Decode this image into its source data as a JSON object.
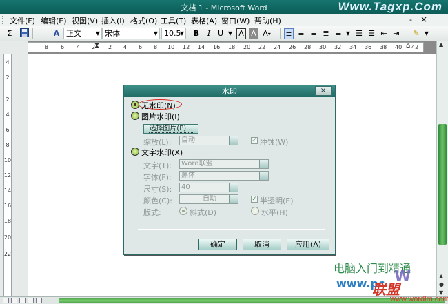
{
  "window": {
    "title": "文档 1 - Microsoft Word",
    "brand_mark": "Www.Tagxp.Com"
  },
  "menu": {
    "items": [
      "文件(F)",
      "编辑(E)",
      "视图(V)",
      "插入(I)",
      "格式(O)",
      "工具(T)",
      "表格(A)",
      "窗口(W)",
      "帮助(H)"
    ],
    "minimize": "-",
    "close": "×"
  },
  "toolbar": {
    "style_value": "正文",
    "font_value": "宋体",
    "size_value": "10.5",
    "bold": "B",
    "italic": "I",
    "underline": "U",
    "font_color": "A"
  },
  "ruler": {
    "h_ticks": [
      "8",
      "6",
      "4",
      "2",
      "2",
      "4",
      "6",
      "8",
      "10",
      "12",
      "14",
      "16",
      "18",
      "20",
      "22",
      "24",
      "26",
      "28",
      "30",
      "32",
      "34",
      "36",
      "38",
      "40",
      "42"
    ],
    "v_ticks": [
      "4",
      "2",
      "2",
      "4",
      "6",
      "8",
      "10",
      "12",
      "14",
      "16",
      "18",
      "20",
      "22"
    ]
  },
  "dialog": {
    "title": "水印",
    "close": "×",
    "no_watermark": "无水印(N)",
    "picture_watermark": "图片水印(I)",
    "select_picture": "选择图片(P)...",
    "scale_label": "缩放(L):",
    "scale_value": "自动",
    "washout": "冲蚀(W)",
    "text_watermark": "文字水印(X)",
    "text_label": "文字(T):",
    "text_value": "Word联盟",
    "font_label": "字体(F):",
    "font_value": "黑体",
    "size_label": "尺寸(S):",
    "size_value": "40",
    "color_label": "颜色(C):",
    "color_value": "自动",
    "semitransparent": "半透明(E)",
    "layout_label": "版式:",
    "diagonal": "斜式(D)",
    "horizontal": "水平(H)",
    "ok": "确定",
    "cancel": "取消",
    "apply": "应用(A)"
  },
  "watermark_text": {
    "line1": "电脑入门到精通",
    "site": "www.pc",
    "word_logo": "W",
    "word_lianmeng": "联盟",
    "url": "www.wordlm.com"
  },
  "colors": {
    "accent": "#1f6a65",
    "titlebar": "#16756f",
    "highlight_ring": "#d9261a",
    "green": "#2b8a4a"
  }
}
